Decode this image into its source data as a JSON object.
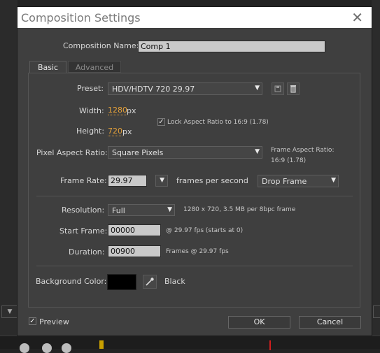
{
  "dialog": {
    "title": "Composition Settings",
    "close_glyph": "✕"
  },
  "composition_name": {
    "label": "Composition Name:",
    "value": "Comp 1"
  },
  "tabs": [
    {
      "label": "Basic",
      "active": true
    },
    {
      "label": "Advanced",
      "active": false
    }
  ],
  "preset": {
    "label": "Preset:",
    "value": "HDV/HDTV 720 29.97",
    "icons": [
      "save-preset-icon",
      "trash-icon"
    ]
  },
  "width": {
    "label": "Width:",
    "value": "1280",
    "unit": "px"
  },
  "height": {
    "label": "Height:",
    "value": "720",
    "unit": "px"
  },
  "lock_aspect": {
    "label": "Lock Aspect Ratio to 16:9 (1.78)",
    "checked": true
  },
  "pixel_aspect": {
    "label": "Pixel Aspect Ratio:",
    "value": "Square Pixels",
    "frame_aspect_label": "Frame Aspect Ratio:",
    "frame_aspect_value": "16:9 (1.78)"
  },
  "frame_rate": {
    "label": "Frame Rate:",
    "value": "29.97",
    "unit": "frames per second",
    "drop": "Drop Frame"
  },
  "resolution": {
    "label": "Resolution:",
    "value": "Full",
    "info": "1280 x 720, 3.5 MB per 8bpc frame"
  },
  "start_frame": {
    "label": "Start Frame:",
    "value": "00000",
    "info": "@ 29.97 fps (starts at 0)"
  },
  "duration": {
    "label": "Duration:",
    "value": "00900",
    "info": "Frames @ 29.97 fps"
  },
  "background": {
    "label": "Background Color:",
    "color": "#000000",
    "name": "Black",
    "icon": "eyedropper-icon"
  },
  "footer": {
    "preview_label": "Preview",
    "preview_checked": true,
    "ok_label": "OK",
    "cancel_label": "Cancel"
  },
  "colors": {
    "accent_orange": "#e3a03a",
    "dialog_bg": "#3f3f3f",
    "field_bg": "#c9c9c9"
  }
}
